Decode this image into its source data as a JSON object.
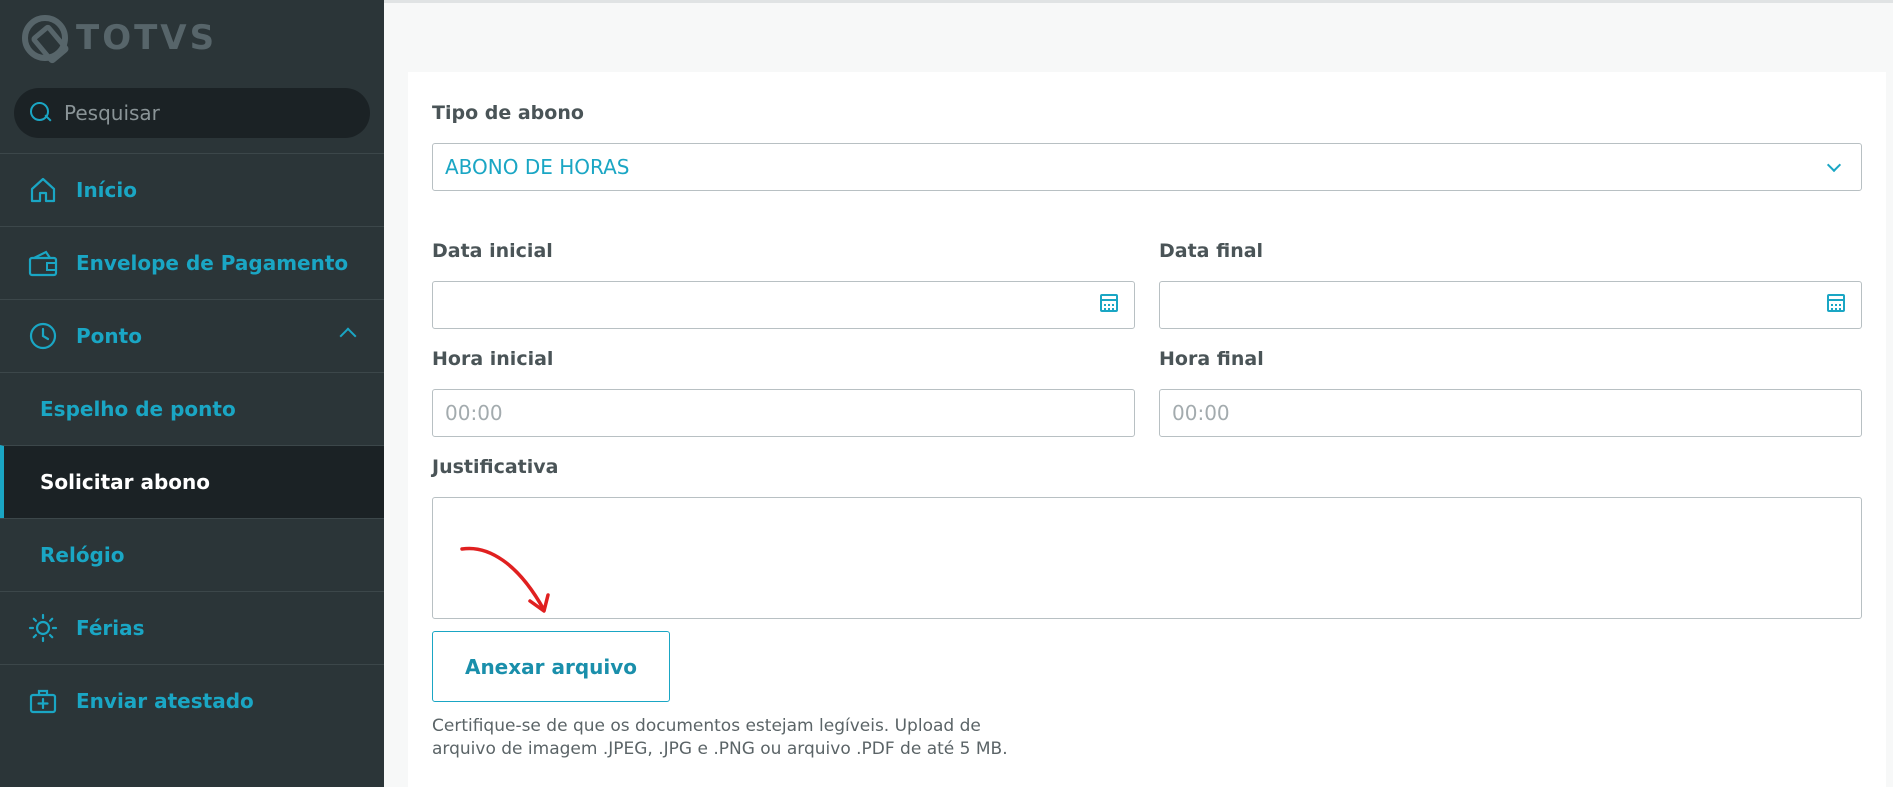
{
  "brand": {
    "name": "TOTVS"
  },
  "search": {
    "placeholder": "Pesquisar"
  },
  "nav": {
    "items": [
      {
        "label": "Início",
        "icon": "home-icon"
      },
      {
        "label": "Envelope de Pagamento",
        "icon": "wallet-icon"
      },
      {
        "label": "Ponto",
        "icon": "clock-icon"
      },
      {
        "label": "Espelho de ponto"
      },
      {
        "label": "Solicitar abono"
      },
      {
        "label": "Relógio"
      },
      {
        "label": "Férias",
        "icon": "sun-icon"
      },
      {
        "label": "Enviar atestado",
        "icon": "medical-case-icon"
      }
    ]
  },
  "form": {
    "tipo_label": "Tipo de abono",
    "tipo_value": "ABONO DE HORAS",
    "data_inicial_label": "Data inicial",
    "data_final_label": "Data final",
    "hora_inicial_label": "Hora inicial",
    "hora_inicial_placeholder": "00:00",
    "hora_final_label": "Hora final",
    "hora_final_placeholder": "00:00",
    "justificativa_label": "Justificativa",
    "attach_label": "Anexar arquivo",
    "help_line1": "Certifique-se de que os documentos estejam legíveis.  Upload de",
    "help_line2": "arquivo de imagem .JPEG, .JPG e .PNG ou arquivo .PDF de até 5 MB."
  },
  "colors": {
    "accent": "#1aa6c4",
    "sidebar": "#2b3538",
    "annotation": "#e02020"
  }
}
